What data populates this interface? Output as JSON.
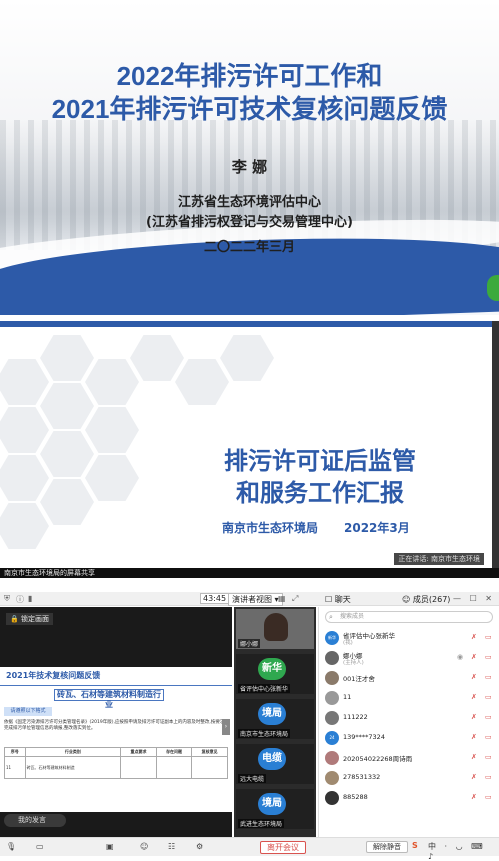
{
  "slide1": {
    "title_line1": "2022年排污许可工作和",
    "title_line2": "2021年排污许可技术复核问题反馈",
    "author": "李  娜",
    "org_line1": "江苏省生态环境评估中心",
    "org_line2": "(江苏省排污权登记与交易管理中心)",
    "date": "二〇二二年三月"
  },
  "slide2": {
    "title_line1": "排污许可证后监管",
    "title_line2": "和服务工作汇报",
    "org": "南京市生态环境局",
    "date": "2022年3月",
    "speaking": "正在讲话: 南京市生态环境",
    "share_label": "南京市生态环境局的屏幕共享"
  },
  "client": {
    "toolbar": {
      "time": "43:45",
      "view_label": "演讲者视图",
      "chat_label": "聊天",
      "members_label": "成员(267)"
    },
    "main": {
      "lock_label": "锁定画面",
      "page_title": "2021年技术复核问题反馈",
      "industry_box": "砖瓦、石材等建筑材料制造行业",
      "pill": "请遵照以下格式",
      "paragraph": "依据《固定污染源排污许可分类管理名录》(2019年版),应按照申请及排污许可证副本上的内容及时整改,按要求完成排污单位管理信息的填报,整改落实到位。",
      "table_headers": [
        "序号",
        "行业类别",
        "重点要求",
        "存在问题",
        "复核意见"
      ],
      "row_number": "11",
      "row_industry": "砖瓦、石材等建筑材料制造",
      "speech_bubble": "我的发言"
    },
    "videos": [
      {
        "name": "娜小娜",
        "avatar": "",
        "color": "#555555"
      },
      {
        "name": "省评估中心张新华",
        "avatar": "新华",
        "color": "#2fa84f"
      },
      {
        "name": "南京市生态环境局",
        "avatar": "境局",
        "color": "#2a7fd4"
      },
      {
        "name": "远大电缆",
        "avatar": "电缆",
        "color": "#2a7fd4"
      },
      {
        "name": "武进生态环境局",
        "avatar": "境局",
        "color": "#2a7fd4"
      }
    ],
    "panel": {
      "search_placeholder": "搜索成员",
      "members": [
        {
          "name": "省评估中心张新华",
          "role": "(我)",
          "avatar": "新华",
          "color": "#2a7fd4"
        },
        {
          "name": "娜小娜",
          "role": "(主持人)",
          "avatar": "",
          "color": "#666666"
        },
        {
          "name": "001汪才舍",
          "role": "",
          "avatar": "",
          "color": "#8a7a6a"
        },
        {
          "name": "11",
          "role": "",
          "avatar": "",
          "color": "#999999"
        },
        {
          "name": "111222",
          "role": "",
          "avatar": "",
          "color": "#777777"
        },
        {
          "name": "139****7324",
          "role": "",
          "avatar": "24",
          "color": "#2a7fd4"
        },
        {
          "name": "2020540222​68周诗雨",
          "role": "",
          "avatar": "",
          "color": "#b07a7a"
        },
        {
          "name": "278531332",
          "role": "",
          "avatar": "",
          "color": "#a08a70"
        },
        {
          "name": "885288",
          "role": "",
          "avatar": "",
          "color": "#333333"
        }
      ]
    },
    "bottombar": {
      "leave_label": "离开会议",
      "unmute_label": "解除静音",
      "ime_label": "S",
      "tray_label": "中 · ◡ ⌨ ♪"
    }
  }
}
